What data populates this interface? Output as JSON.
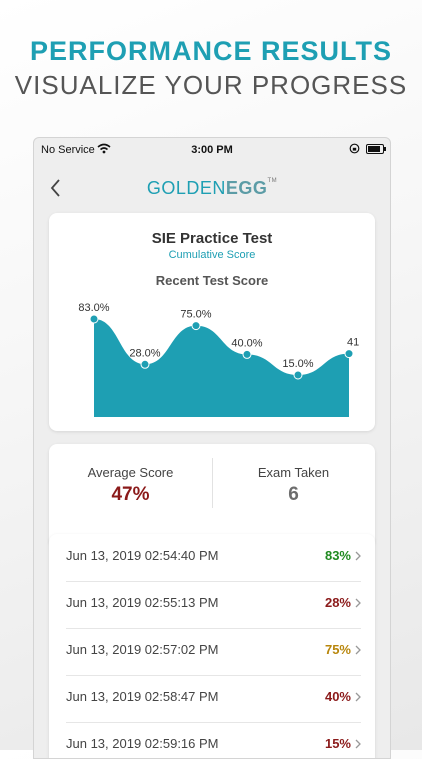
{
  "promo": {
    "title": "PERFORMANCE RESULTS",
    "subtitle": "VISUALIZE YOUR PROGRESS"
  },
  "status_bar": {
    "carrier": "No Service",
    "time": "3:00 PM",
    "icons": [
      "wifi-icon",
      "rotation-lock-icon",
      "battery-icon"
    ]
  },
  "nav": {
    "back_icon": "chevron-left-icon",
    "logo_main": "GOLDEN",
    "logo_accent": "EGG",
    "logo_tm": "TM"
  },
  "chart_card": {
    "title": "SIE Practice Test",
    "subtitle": "Cumulative Score"
  },
  "chart_data": {
    "type": "area",
    "title": "Recent Test Score",
    "xlabel": "",
    "ylabel": "",
    "values": [
      83.0,
      28.0,
      75.0,
      40.0,
      15.0,
      41.0
    ],
    "labels": [
      "83.0%",
      "28.0%",
      "75.0%",
      "40.0%",
      "15.0%",
      "41"
    ],
    "ylim": [
      0,
      100
    ],
    "grid": false,
    "color": "#1e9fb3"
  },
  "stats": {
    "average_label": "Average Score",
    "average_value": "47%",
    "exam_label": "Exam Taken",
    "exam_value": "6"
  },
  "history": {
    "items": [
      {
        "date": "Jun 13, 2019 02:54:40 PM",
        "score": "83%",
        "color": "#1f8a1f"
      },
      {
        "date": "Jun 13, 2019 02:55:13 PM",
        "score": "28%",
        "color": "#8b1a1a"
      },
      {
        "date": "Jun 13, 2019 02:57:02 PM",
        "score": "75%",
        "color": "#b8860b"
      },
      {
        "date": "Jun 13, 2019 02:58:47 PM",
        "score": "40%",
        "color": "#8b1a1a"
      },
      {
        "date": "Jun 13, 2019 02:59:16 PM",
        "score": "15%",
        "color": "#8b1a1a"
      }
    ]
  },
  "colors": {
    "accent": "#1e9fb3",
    "average": "#8b1a1a"
  }
}
